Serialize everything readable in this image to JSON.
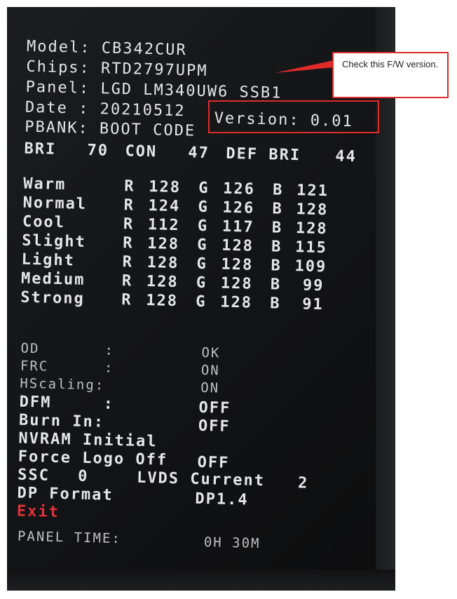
{
  "info": {
    "model": "Model: CB342CUR",
    "chips": "Chips: RTD2797UPM",
    "panel": "Panel: LGD LM340UW6 SSB1",
    "date": "Date : 20210512",
    "version": "Version: 0.01",
    "pbank": "PBANK: BOOT CODE"
  },
  "levels": {
    "bri_label": "BRI",
    "bri": "70",
    "con_label": "CON",
    "con": "47",
    "def_bri_label": "DEF BRI",
    "def_bri": "44"
  },
  "color_temps": [
    {
      "name": "Warm",
      "r": "128",
      "g": "126",
      "b": "121"
    },
    {
      "name": "Normal",
      "r": "124",
      "g": "126",
      "b": "128"
    },
    {
      "name": "Cool",
      "r": "112",
      "g": "117",
      "b": "128"
    },
    {
      "name": "Slight",
      "r": "128",
      "g": "128",
      "b": "115"
    },
    {
      "name": "Light",
      "r": "128",
      "g": "128",
      "b": "109"
    },
    {
      "name": "Medium",
      "r": "128",
      "g": "128",
      "b": "99"
    },
    {
      "name": "Strong",
      "r": "128",
      "g": "128",
      "b": "91"
    }
  ],
  "channel_labels": {
    "r": "R",
    "g": "G",
    "b": "B"
  },
  "settings": {
    "od_label": "OD",
    "od_sep": ":",
    "od_value": "OK",
    "frc_label": "FRC",
    "frc_sep": ":",
    "frc_value": "ON",
    "hscaling_label": "HScaling:",
    "hscaling_value": "ON",
    "dfm_label": "DFM",
    "dfm_sep": ":",
    "dfm_value": "OFF",
    "burnin_label": "Burn In:",
    "burnin_value": "OFF",
    "nvram_label": "NVRAM Initial",
    "forcelogo_label": "Force Logo Off",
    "forcelogo_value": "OFF",
    "ssc_label": "SSC",
    "ssc_value": "0",
    "lvds_label": "LVDS Current",
    "lvds_value": "2",
    "dp_label": "DP Format",
    "dp_value": "DP1.4",
    "exit_label": "Exit",
    "panel_time_label": "PANEL TIME:",
    "panel_time_value": "0H 30M"
  },
  "annotation": {
    "note": "Check this F/W version.",
    "accent": "#e02b2b"
  }
}
